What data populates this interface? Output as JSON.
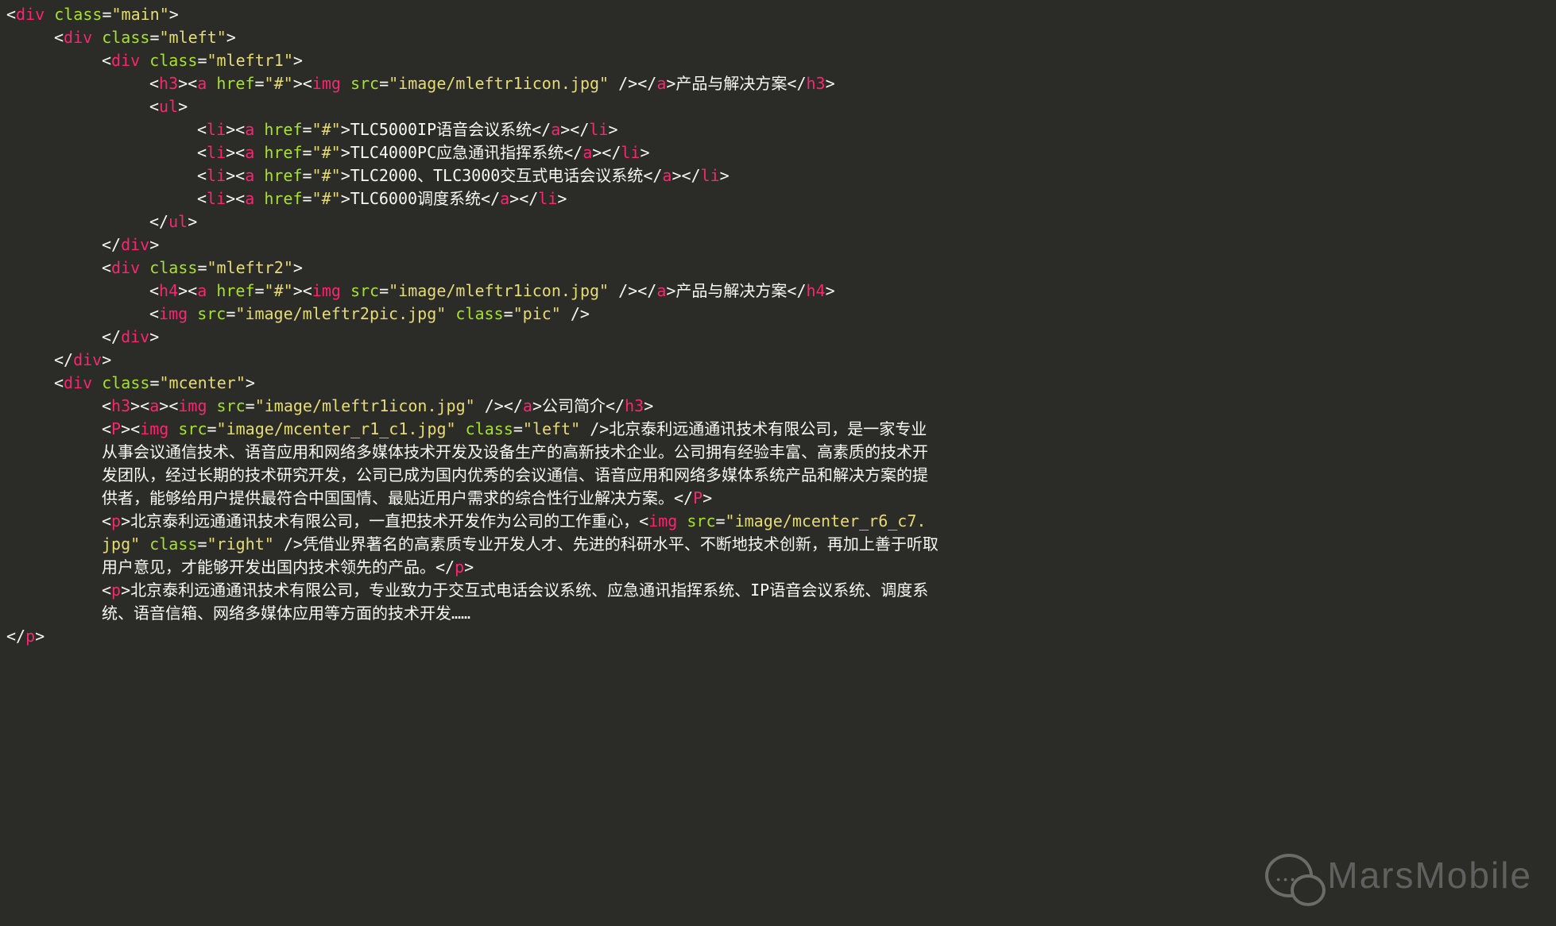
{
  "code": {
    "main_div_open": {
      "tag": "div",
      "attr": "class",
      "val": "main"
    },
    "mleft_open": {
      "tag": "div",
      "attr": "class",
      "val": "mleft"
    },
    "mleftr1_open": {
      "tag": "div",
      "attr": "class",
      "val": "mleftr1"
    },
    "h3_a_img": {
      "h": "h3",
      "a": "a",
      "href_attr": "href",
      "href_val": "#",
      "img": "img",
      "src_attr": "src",
      "src_val": "image/mleftr1icon.jpg",
      "text": "产品与解决方案"
    },
    "ul_tag": "ul",
    "li_items": [
      {
        "li": "li",
        "a": "a",
        "href_attr": "href",
        "href_val": "#",
        "text": "TLC5000IP语音会议系统"
      },
      {
        "li": "li",
        "a": "a",
        "href_attr": "href",
        "href_val": "#",
        "text": "TLC4000PC应急通讯指挥系统"
      },
      {
        "li": "li",
        "a": "a",
        "href_attr": "href",
        "href_val": "#",
        "text": "TLC2000、TLC3000交互式电话会议系统"
      },
      {
        "li": "li",
        "a": "a",
        "href_attr": "href",
        "href_val": "#",
        "text": "TLC6000调度系统"
      }
    ],
    "ul_close": "ul",
    "div_close": "div",
    "mleftr2_open": {
      "tag": "div",
      "attr": "class",
      "val": "mleftr2"
    },
    "h4_a_img": {
      "h": "h4",
      "a": "a",
      "href_attr": "href",
      "href_val": "#",
      "img": "img",
      "src_attr": "src",
      "src_val": "image/mleftr1icon.jpg",
      "text": "产品与解决方案"
    },
    "mleftr2_img": {
      "img": "img",
      "src_attr": "src",
      "src_val": "image/mleftr2pic.jpg",
      "class_attr": "class",
      "class_val": "pic"
    },
    "mcenter_open": {
      "tag": "div",
      "attr": "class",
      "val": "mcenter"
    },
    "h3_center": {
      "h": "h3",
      "a": "a",
      "img": "img",
      "src_attr": "src",
      "src_val": "image/mleftr1icon.jpg",
      "text": "公司简介"
    },
    "p1": {
      "P": "P",
      "img": "img",
      "src_attr": "src",
      "src_val": "image/mcenter_r1_c1.jpg",
      "class_attr": "class",
      "class_val": "left",
      "text_a": "北京泰利远通通讯技术有限公司，是一家专业",
      "text_b": "从事会议通信技术、语音应用和网络多媒体技术开发及设备生产的高新技术企业。公司拥有经验丰富、高素质的技术开",
      "text_c": "发团队，经过长期的技术研究开发，公司已成为国内优秀的会议通信、语音应用和网络多媒体系统产品和解决方案的提",
      "text_d": "供者，能够给用户提供最符合中国国情、最贴近用户需求的综合性行业解决方案。"
    },
    "p2": {
      "p": "p",
      "text_a": "北京泰利远通通讯技术有限公司，一直把技术开发作为公司的工作重心，",
      "img": "img",
      "src_attr": "src",
      "src_val": "image/mcenter_r6_c7.",
      "src_val2": "jpg",
      "class_attr": "class",
      "class_val": "right",
      "text_b": "凭借业界著名的高素质专业开发人才、先进的科研水平、不断地技术创新，再加上善于听取",
      "text_c": "用户意见，才能够开发出国内技术领先的产品。"
    },
    "p3": {
      "p": "p",
      "text_a": "北京泰利远通通讯技术有限公司，专业致力于交互式电话会议系统、应急通讯指挥系统、IP语音会议系统、调度系",
      "text_b": "统、语音信箱、网络多媒体应用等方面的技术开发……"
    },
    "final_close": "p"
  },
  "watermark": "MarsMobile"
}
